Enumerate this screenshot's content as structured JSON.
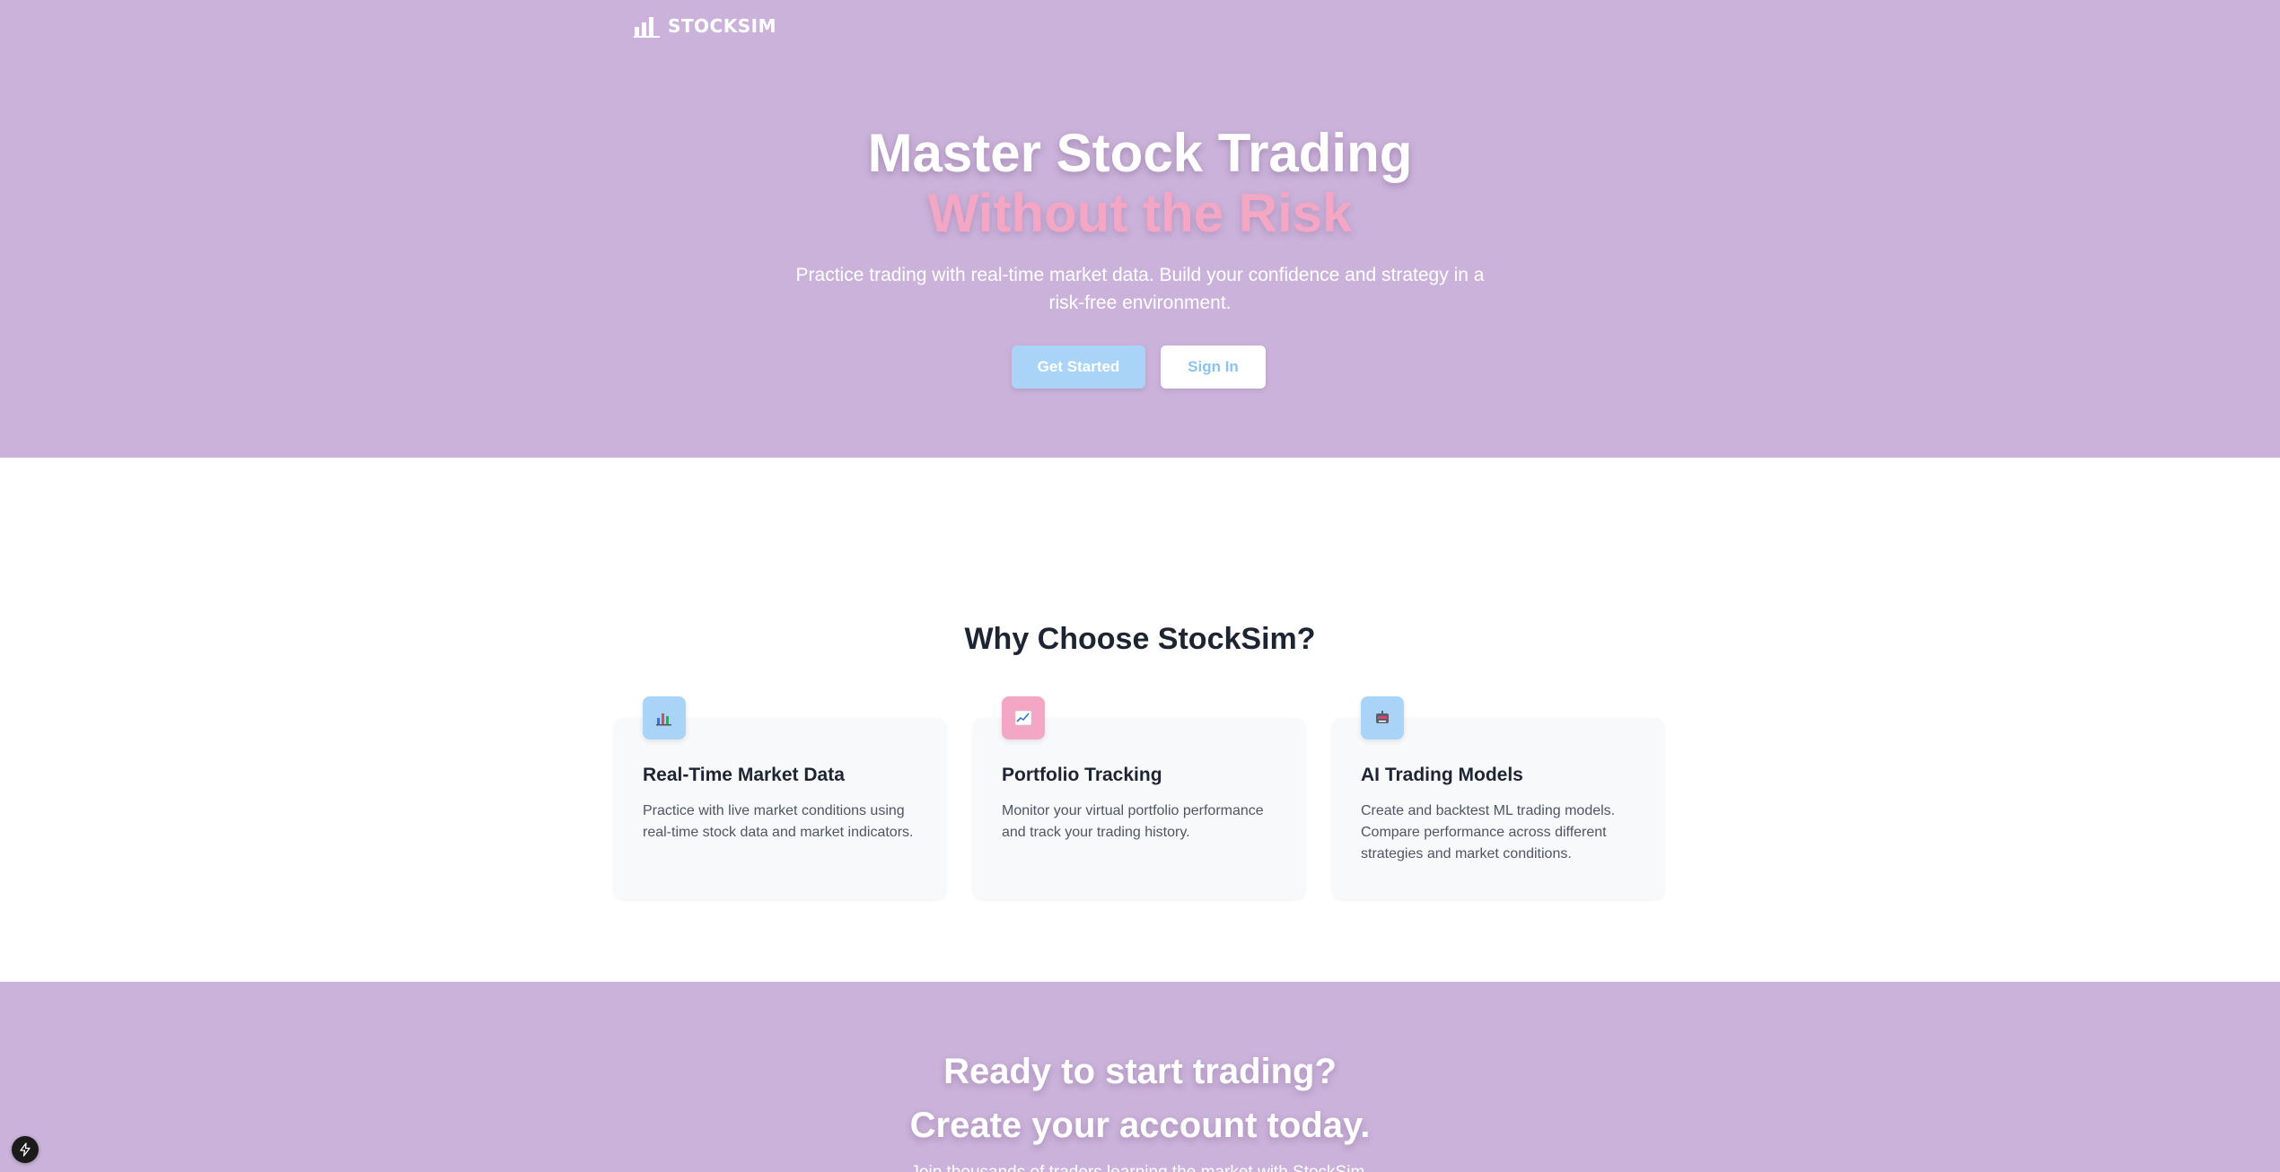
{
  "brand": {
    "name": "STOCKSIM",
    "logo_icon": "bar-chart-icon"
  },
  "hero": {
    "title_line1": "Master Stock Trading",
    "title_line2": "Without the Risk",
    "subtitle": "Practice trading with real-time market data. Build your confidence and strategy in a risk-free environment.",
    "primary_button": "Get Started",
    "secondary_button": "Sign In"
  },
  "features": {
    "title": "Why Choose StockSim?",
    "cards": [
      {
        "icon": "bar-chart-icon",
        "icon_bg": "#a9d4f7",
        "title": "Real-Time Market Data",
        "description": "Practice with live market conditions using real-time stock data and market indicators."
      },
      {
        "icon": "trending-chart-icon",
        "icon_bg": "#f4a7c4",
        "title": "Portfolio Tracking",
        "description": "Monitor your virtual portfolio performance and track your trading history."
      },
      {
        "icon": "robot-icon",
        "icon_bg": "#a9d4f7",
        "title": "AI Trading Models",
        "description": "Create and backtest ML trading models. Compare performance across different strategies and market conditions."
      }
    ]
  },
  "cta": {
    "title_line1": "Ready to start trading?",
    "title_line2": "Create your account today.",
    "subtitle": "Join thousands of traders learning the market with StockSim."
  },
  "badge": {
    "icon": "lightning-icon"
  },
  "colors": {
    "hero_bg": "#cbb2da",
    "accent_pink": "#f4a7c4",
    "accent_blue": "#a9d4f7",
    "text_dark": "#1e2532"
  }
}
